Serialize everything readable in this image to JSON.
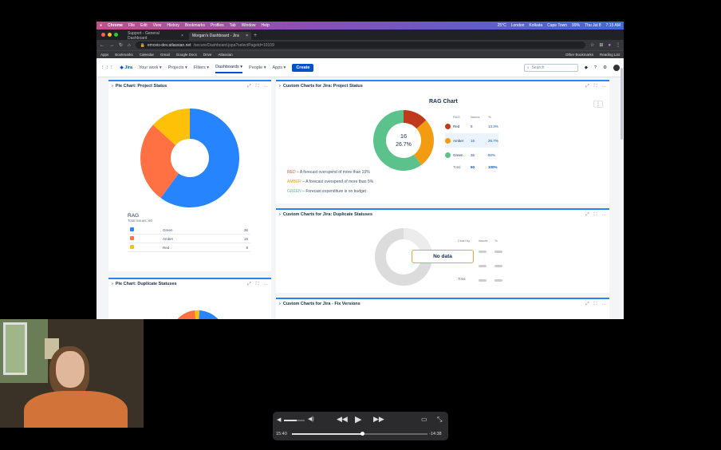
{
  "mac": {
    "app": "Chrome",
    "menus": [
      "File",
      "Edit",
      "View",
      "History",
      "Bookmarks",
      "Profiles",
      "Tab",
      "Window",
      "Help"
    ],
    "status": [
      "25°C",
      "London",
      "Kolkata",
      "Cape Town",
      "99%",
      "Thu Jul 8",
      "7:15 AM"
    ]
  },
  "browser": {
    "tabs": [
      {
        "label": "Support - General Dashboard",
        "active": false
      },
      {
        "label": "Morgan's Dashboard - Jira",
        "active": true
      }
    ],
    "url_host": "emovis-dev.atlassian.net",
    "url_path": "/secure/Dashboard.jspa?selectPageId=10109",
    "bookmarks": [
      "Apps",
      "Bookmarks",
      "Calendar",
      "Gmail",
      "Google Docs",
      "Drive",
      "Atlassian"
    ],
    "other_bookmarks": "Other Bookmarks",
    "reading_list": "Reading List"
  },
  "jira": {
    "brand": "Jira",
    "nav": [
      "Your work",
      "Projects",
      "Filters",
      "Dashboards",
      "People",
      "Apps"
    ],
    "selected_nav": "Dashboards",
    "create": "Create",
    "search_placeholder": "Search"
  },
  "g1": {
    "title": "Pie Chart: Project Status",
    "rag_title": "RAG",
    "total": "Total issues: 60",
    "rows": [
      {
        "label": "Green",
        "value": "36",
        "color": "#2684ff"
      },
      {
        "label": "Amber",
        "value": "16",
        "color": "#ff7043"
      },
      {
        "label": "Red",
        "value": "8",
        "color": "#ffc107"
      }
    ]
  },
  "g2": {
    "title": "Pie Chart: Duplicate Statuses"
  },
  "g3": {
    "title": "Custom Charts for Jira: Project Status",
    "chart_title": "RAG Chart",
    "center_count": "16",
    "center_pct": "26.7%",
    "headers": [
      "RAG",
      "Issues",
      "%"
    ],
    "rows": [
      {
        "label": "Red",
        "issues": "8",
        "pct": "13.3%",
        "color": "#c0391b"
      },
      {
        "label": "Amber",
        "issues": "16",
        "pct": "26.7%",
        "color": "#f39c12"
      },
      {
        "label": "Green",
        "issues": "36",
        "pct": "60%",
        "color": "#5bc28c"
      }
    ],
    "total_label": "Total",
    "total_issues": "60",
    "total_pct": "100%",
    "notes": [
      {
        "key": "RED",
        "text": " – A forecast overspend of more than 10%",
        "color": "#e74c3c"
      },
      {
        "key": "AMBER",
        "text": " – A forecast overspend of more than 5%",
        "color": "#f39c12"
      },
      {
        "key": "GREEN",
        "text": " – Forecast expenditure is on budget",
        "color": "#5bc28c"
      }
    ]
  },
  "g4": {
    "title": "Custom Charts for Jira: Duplicate Statuses",
    "no_data": "No data",
    "headers": [
      "Chart by",
      "Issues",
      "%"
    ],
    "total_label": "Total"
  },
  "g5": {
    "title": "Custom Charts for Jira - Fix Versions"
  },
  "player": {
    "elapsed": "15:40",
    "remaining": "-14:38",
    "progress": 0.52,
    "volume": 0.62
  },
  "chart_data": [
    {
      "type": "pie",
      "title": "Pie Chart: Project Status",
      "categories": [
        "Green",
        "Amber",
        "Red"
      ],
      "values": [
        36,
        16,
        8
      ]
    },
    {
      "type": "pie",
      "title": "RAG Chart",
      "categories": [
        "Red",
        "Amber",
        "Green"
      ],
      "values": [
        8,
        16,
        36
      ]
    }
  ]
}
